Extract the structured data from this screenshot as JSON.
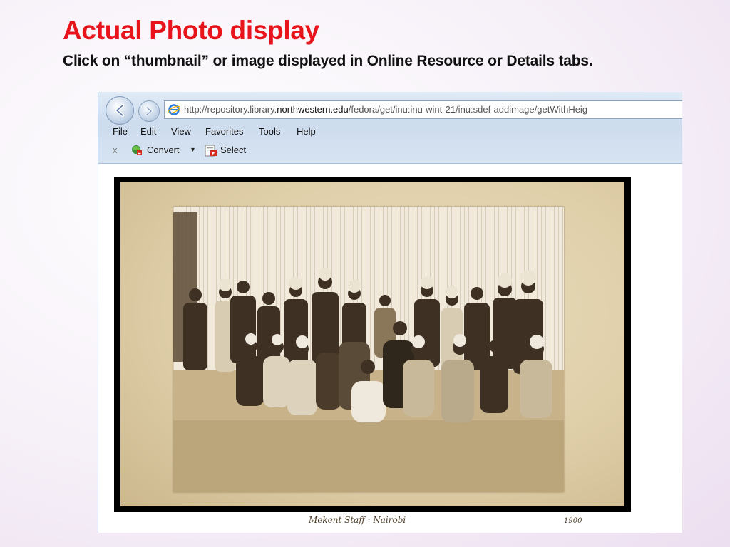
{
  "slide": {
    "title": "Actual Photo display",
    "subtitle": "Click on  “thumbnail” or image displayed in Online Resource or Details tabs."
  },
  "browser": {
    "address": {
      "prefix": "http://repository.library.",
      "domain": "northwestern.edu",
      "suffix": "/fedora/get/inu:inu-wint-21/inu:sdef-addimage/getWithHeig"
    },
    "menu": [
      "File",
      "Edit",
      "View",
      "Favorites",
      "Tools",
      "Help"
    ],
    "toolbar": {
      "close": "x",
      "convert_label": "Convert",
      "caret": "▾",
      "select_label": "Select"
    },
    "icons": {
      "back": "back-arrow-icon",
      "forward": "forward-arrow-icon",
      "ie": "internet-explorer-icon",
      "search": "search-icon",
      "refresh": "refresh-icon",
      "convert": "pdf-convert-icon",
      "select": "pdf-select-icon"
    }
  },
  "photo": {
    "caption_left": "Mekent Staff · Nairobi",
    "caption_right": "1900"
  },
  "colors": {
    "title": "#e8141b",
    "chrome": "#d6e3f2",
    "sepia": "#dfcfa9"
  }
}
